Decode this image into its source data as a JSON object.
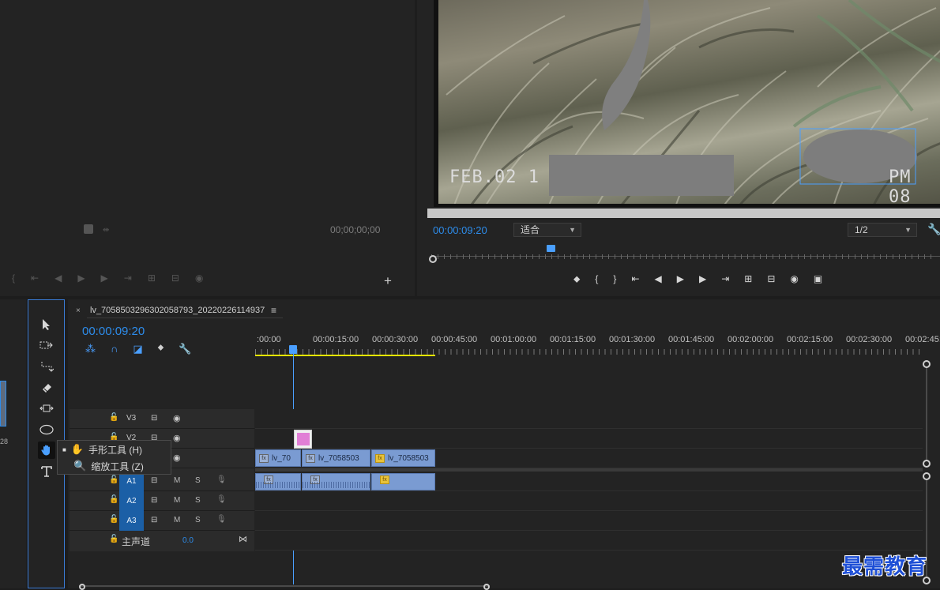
{
  "source": {
    "timecode": "00;00;00;00"
  },
  "program": {
    "overlay_text": "FEB.02 1",
    "overlay_text_right": "PM 08",
    "timecode": "00:00:09:20",
    "fit_select": "适合",
    "resolution_select": "1/2"
  },
  "timeline": {
    "sequence_name": "lv_7058503296302058793_20220226114937",
    "timecode": "00:00:09:20",
    "ruler_labels": [
      ":00:00",
      "00:00:15:00",
      "00:00:30:00",
      "00:00:45:00",
      "00:01:00:00",
      "00:01:15:00",
      "00:01:30:00",
      "00:01:45:00",
      "00:02:00:00",
      "00:02:15:00",
      "00:02:30:00",
      "00:02:45:"
    ],
    "tracks": {
      "v3": "V3",
      "v2": "V2",
      "a1": "A1",
      "a2": "A2",
      "a3": "A3",
      "master": "主声道",
      "master_value": "0.0",
      "m": "M",
      "s": "S"
    },
    "clips": {
      "clip1": "lv_70",
      "clip2": "lv_7058503",
      "clip3": "lv_7058503",
      "fx": "fx"
    }
  },
  "tool_flyout": {
    "hand": "手形工具 (H)",
    "zoom": "缩放工具 (Z)"
  },
  "watermark": "最需教育",
  "left_edge_label": "28",
  "colors": {
    "accent": "#2d8ceb",
    "clip": "#7a9bd2",
    "work_area": "#e5e500",
    "fx_badge": "#e8c33b"
  }
}
